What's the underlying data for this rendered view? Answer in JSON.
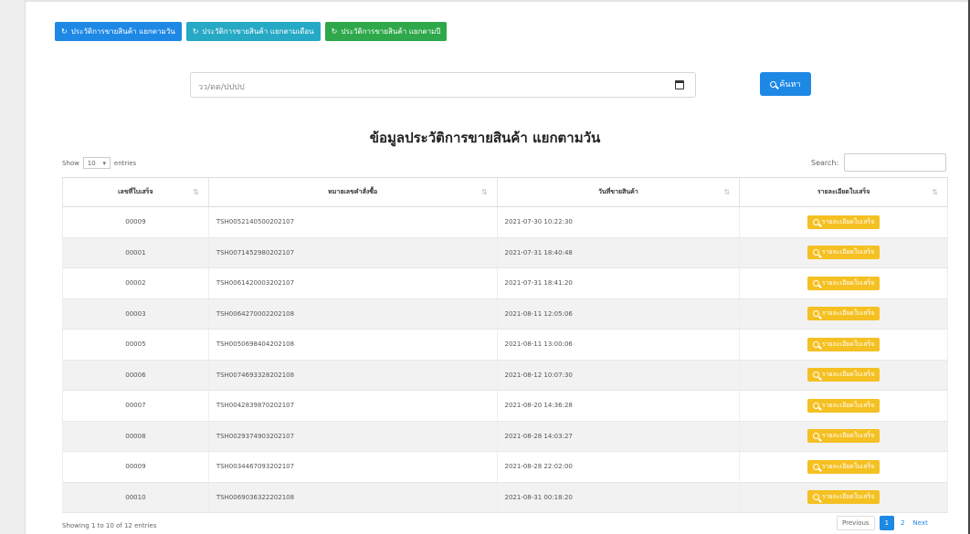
{
  "tabs": [
    {
      "label": "ประวัติการขายสินค้า แยกตามวัน",
      "color": "#1e88e5",
      "icon": "history-icon"
    },
    {
      "label": "ประวัติการขายสินค้า แยกตามเดือน",
      "color": "#26a9c4",
      "icon": "history-icon"
    },
    {
      "label": "ประวัติการขายสินค้า แยกตามปี",
      "color": "#2ea84a",
      "icon": "history-icon"
    }
  ],
  "date_filter": {
    "value": "วว/ดด/ปปปป"
  },
  "search_button": {
    "label": "ค้นหา"
  },
  "page_title": "ข้อมูลประวัติการขายสินค้า แยกตามวัน",
  "table_controls": {
    "show_label": "Show",
    "page_size": "10",
    "entries_label": "entries",
    "search_label": "Search:"
  },
  "table": {
    "headers": [
      "เลขที่ใบเสร็จ",
      "หมายเลขคำสั่งซื้อ",
      "วันที่ขายสินค้า",
      "รายละเอียดใบเสร็จ"
    ],
    "detail_label": "รายละเอียดใบเสร็จ",
    "rows": [
      {
        "receipt": "00009",
        "order": "TSH0052140500202107",
        "date": "2021-07-30 10:22:30"
      },
      {
        "receipt": "00001",
        "order": "TSH0071452980202107",
        "date": "2021-07-31 18:40:48"
      },
      {
        "receipt": "00002",
        "order": "TSH0061420003202107",
        "date": "2021-07-31 18:41:20"
      },
      {
        "receipt": "00003",
        "order": "TSH0064270002202108",
        "date": "2021-08-11 12:05:06"
      },
      {
        "receipt": "00005",
        "order": "TSH0050698404202108",
        "date": "2021-08-11 13:00:06"
      },
      {
        "receipt": "00006",
        "order": "TSH0074693328202108",
        "date": "2021-08-12 10:07:30"
      },
      {
        "receipt": "00007",
        "order": "TSH0042839870202107",
        "date": "2021-08-20 14:36:28"
      },
      {
        "receipt": "00008",
        "order": "TSH0029374903202107",
        "date": "2021-08-28 14:03:27"
      },
      {
        "receipt": "00009",
        "order": "TSH0034467093202107",
        "date": "2021-08-28 22:02:00"
      },
      {
        "receipt": "00010",
        "order": "TSH0069036322202108",
        "date": "2021-08-31 00:18:20"
      }
    ]
  },
  "table_info": "Showing 1 to 10 of 12 entries",
  "pagination": {
    "previous": "Previous",
    "pages": [
      "1",
      "2"
    ],
    "next": "Next"
  },
  "colors": {
    "primary": "#1e88e5",
    "info": "#26a9c4",
    "success": "#2ea84a",
    "warning": "#f5c021"
  }
}
